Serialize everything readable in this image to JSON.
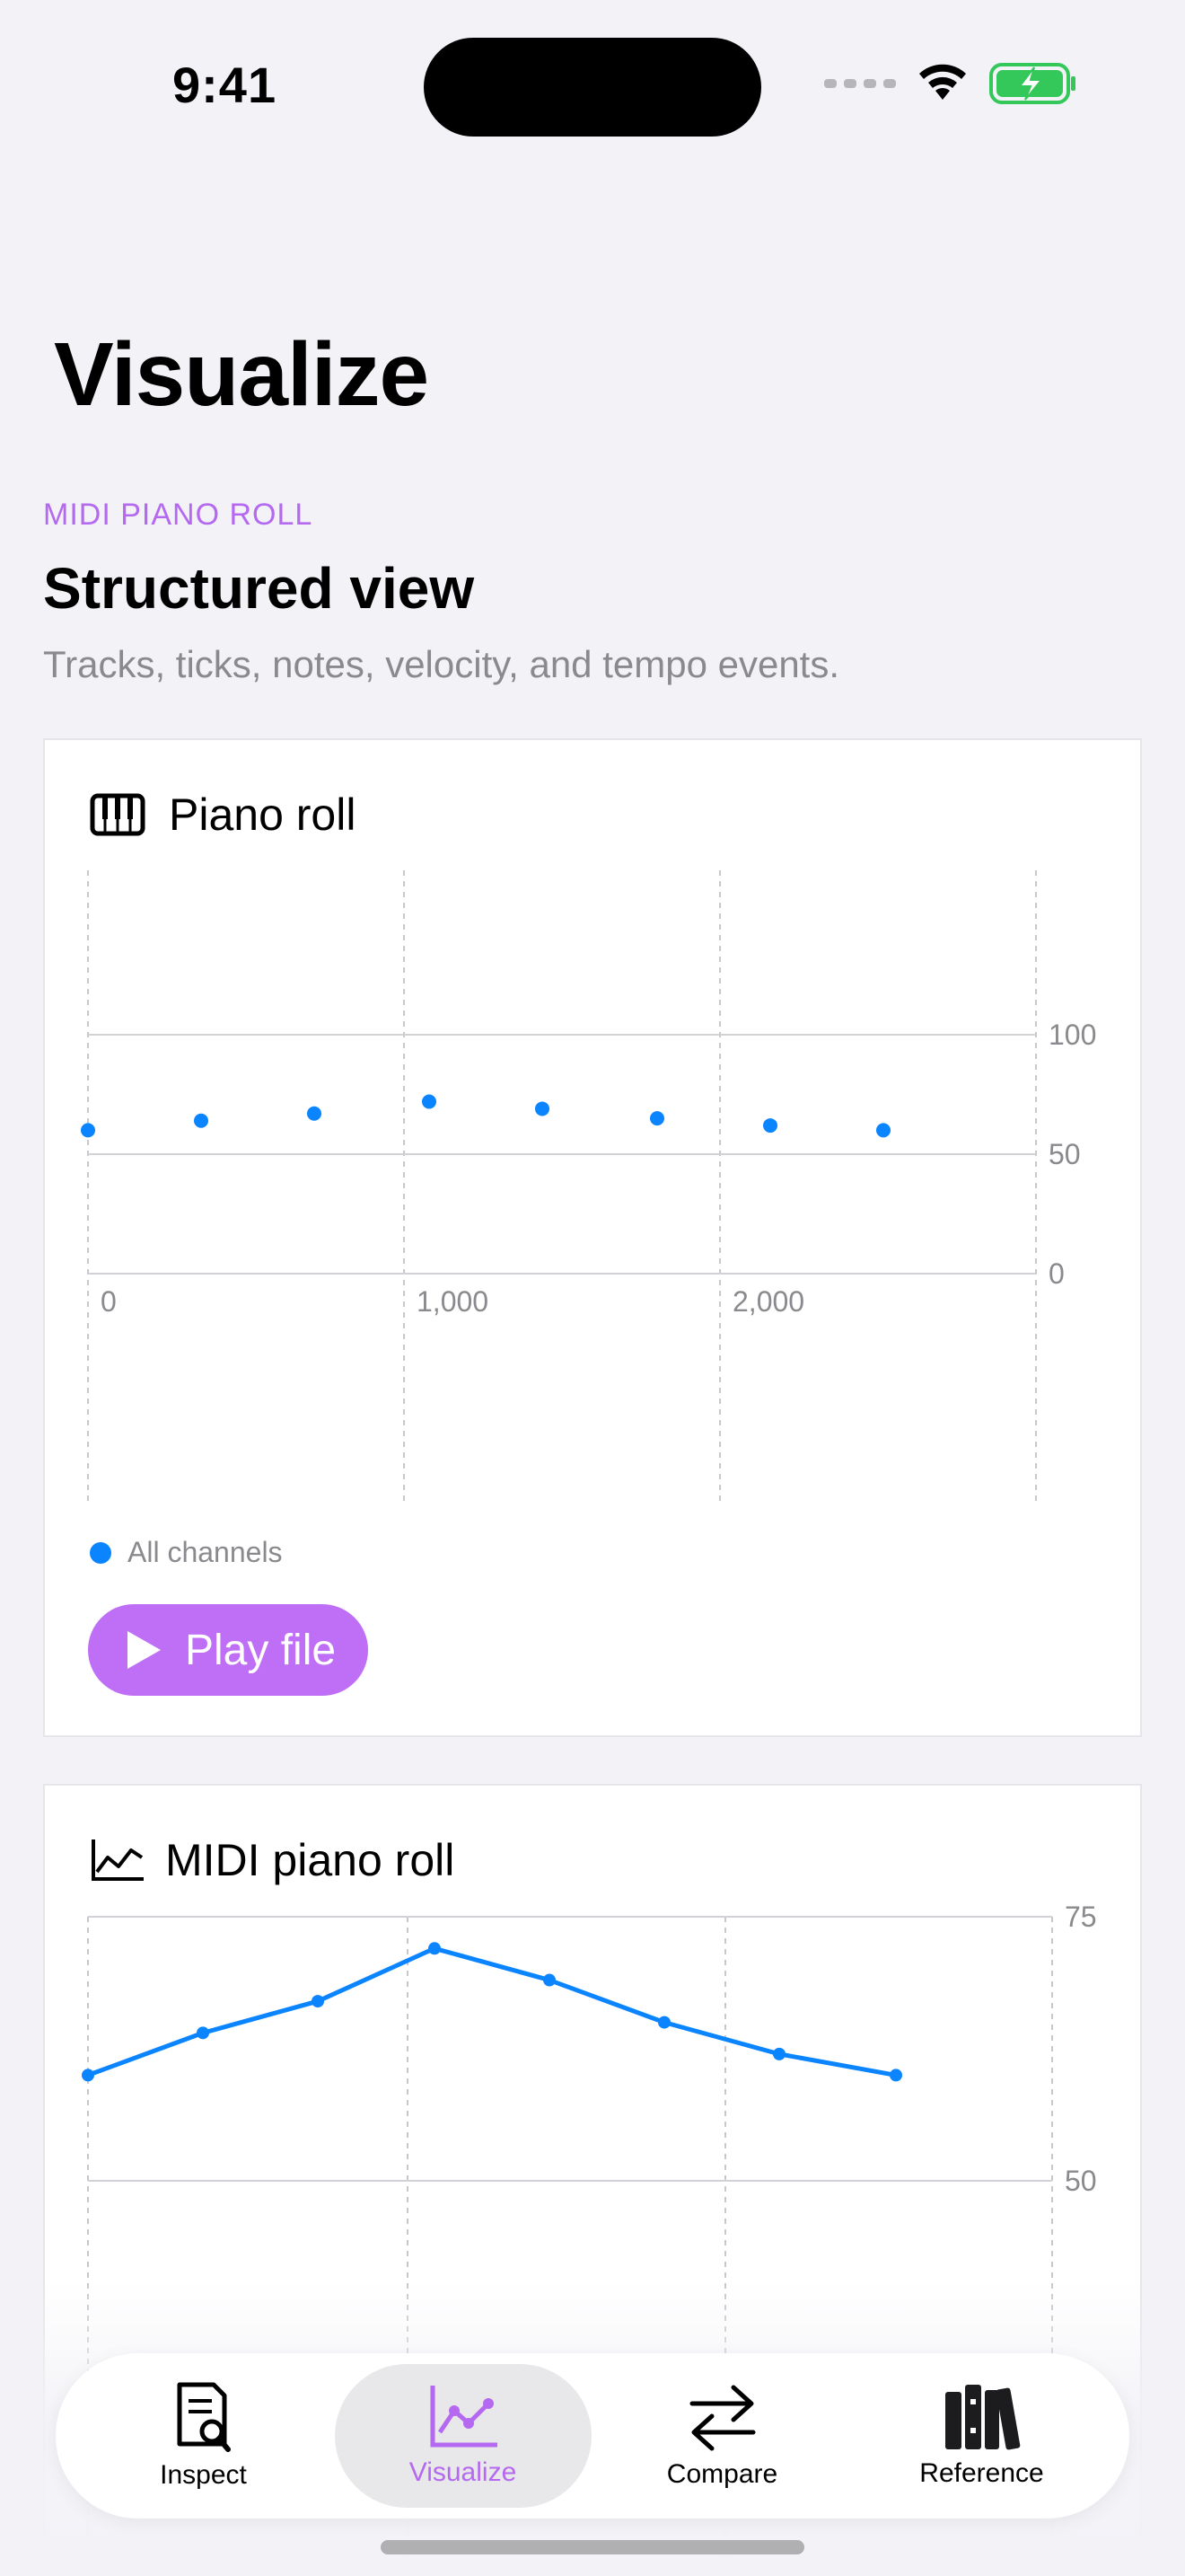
{
  "status_bar": {
    "time": "9:41"
  },
  "header": {
    "title": "Visualize"
  },
  "section": {
    "eyebrow": "MIDI PIANO ROLL",
    "title": "Structured view",
    "subtitle": "Tracks, ticks, notes, velocity, and tempo events."
  },
  "piano_card": {
    "title": "Piano roll",
    "icon": "piano-keys-icon",
    "legend": "All channels",
    "play_label": "Play file"
  },
  "line_card": {
    "title": "MIDI piano roll",
    "icon": "line-chart-icon"
  },
  "tabs": [
    {
      "label": "Inspect",
      "icon": "document-search-icon",
      "active": false
    },
    {
      "label": "Visualize",
      "icon": "line-chart-icon",
      "active": true
    },
    {
      "label": "Compare",
      "icon": "swap-arrows-icon",
      "active": false
    },
    {
      "label": "Reference",
      "icon": "books-icon",
      "active": false
    }
  ],
  "colors": {
    "accent": "#bf6ff5",
    "series": "#0a84ff",
    "background": "#f2f2f7"
  },
  "chart_data": [
    {
      "type": "scatter",
      "x": [
        0,
        360,
        720,
        1080,
        1440,
        1800,
        2160,
        2520
      ],
      "y": [
        60,
        64,
        67,
        72,
        69,
        65,
        62,
        60
      ],
      "series": [
        {
          "name": "All channels"
        }
      ],
      "xticks": [
        "0",
        "1,000",
        "2,000"
      ],
      "yticks": [
        "0",
        "50",
        "100"
      ],
      "xlim": [
        0,
        3000
      ],
      "ylim": [
        0,
        127
      ],
      "grid": true,
      "legend": "bottom-left"
    },
    {
      "type": "line",
      "x": [
        0,
        360,
        720,
        1080,
        1440,
        1800,
        2160,
        2520
      ],
      "y": [
        60,
        64,
        67,
        72,
        69,
        65,
        62,
        60
      ],
      "yticks": [
        "50",
        "75"
      ],
      "ylim": [
        25,
        75
      ],
      "grid": true
    }
  ]
}
